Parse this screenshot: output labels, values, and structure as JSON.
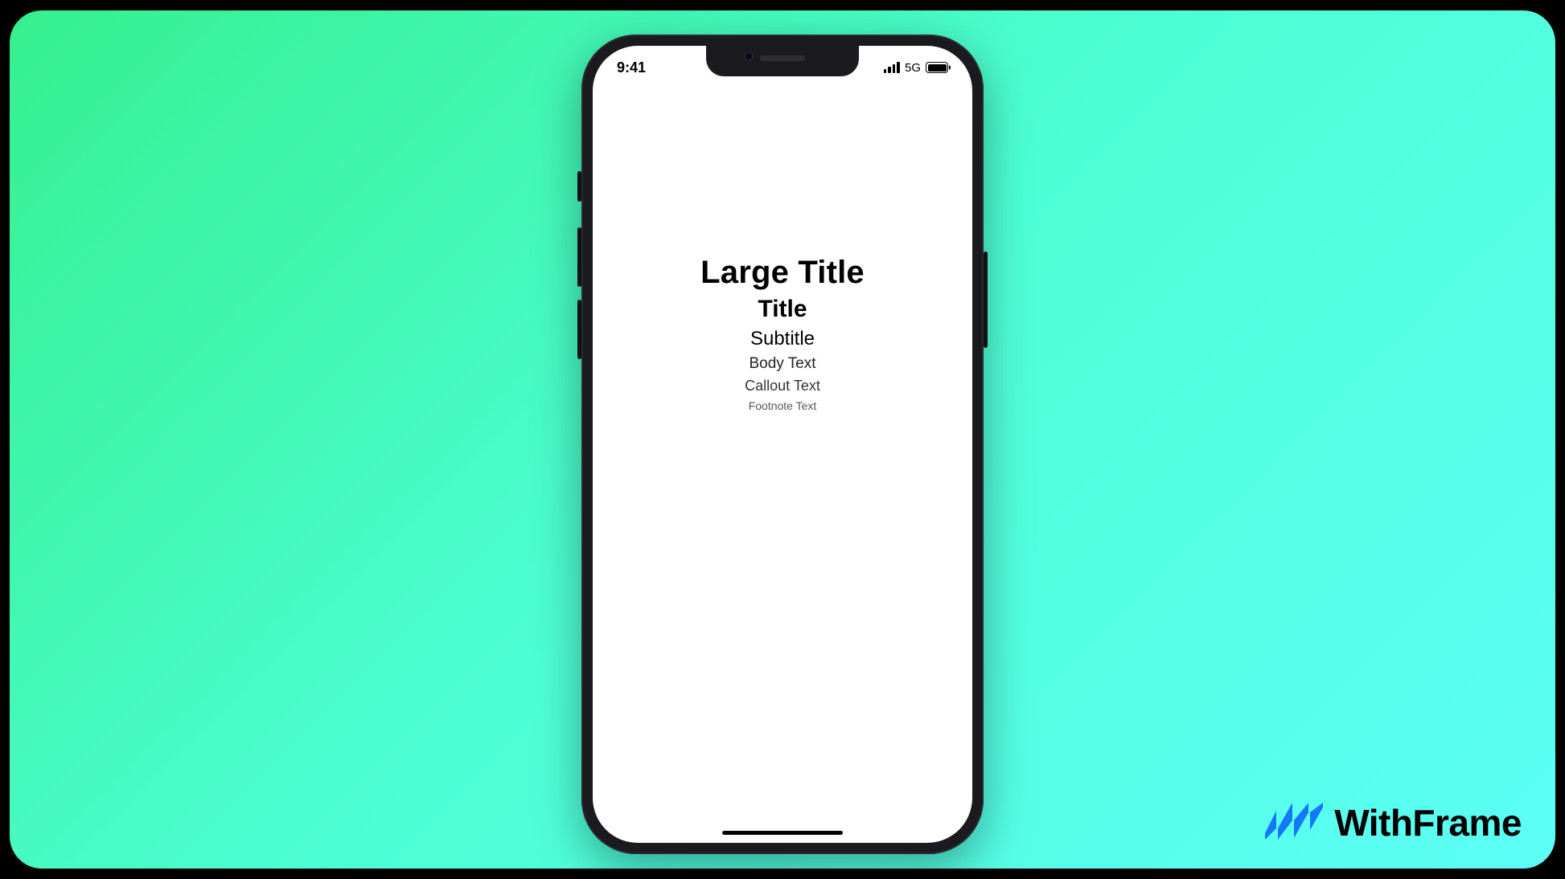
{
  "status": {
    "time": "9:41",
    "network": "5G"
  },
  "typography": {
    "large_title": "Large Title",
    "title": "Title",
    "subtitle": "Subtitle",
    "body": "Body Text",
    "callout": "Callout Text",
    "footnote": "Footnote Text"
  },
  "brand": {
    "name": "WithFrame"
  }
}
